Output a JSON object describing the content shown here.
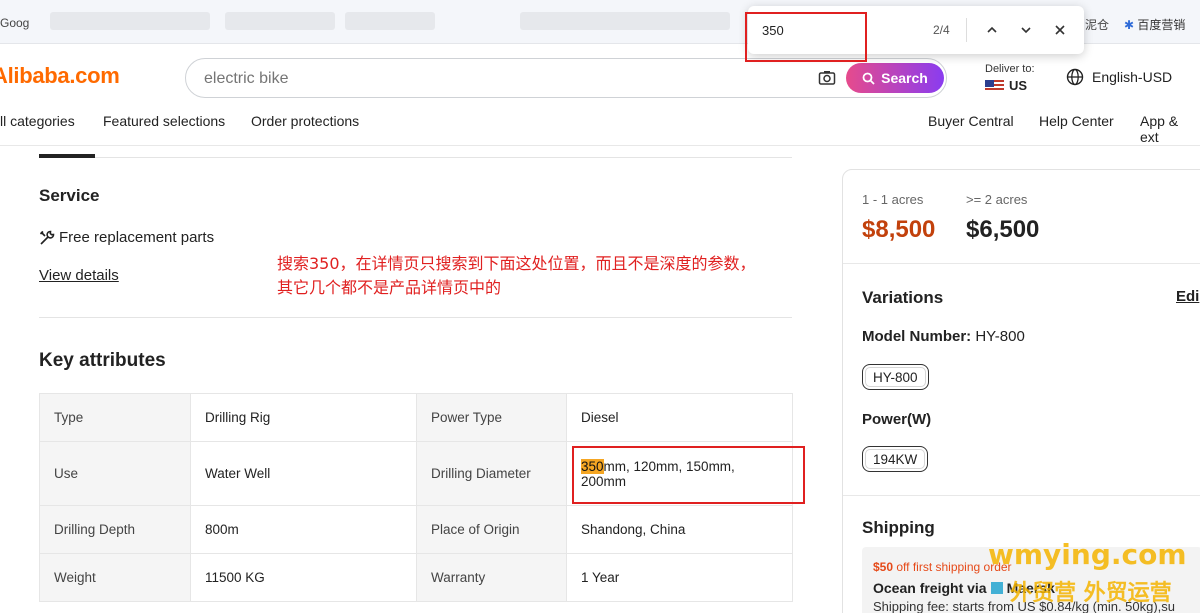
{
  "bookmarks": {
    "first": "Goog",
    "right_1": "泥仓",
    "right_2": "百度营销"
  },
  "findbar": {
    "query": "350",
    "count": "2/4"
  },
  "header": {
    "logo": "Alibaba.com",
    "search_placeholder": "electric bike",
    "search_button": "Search",
    "deliver_label": "Deliver to:",
    "deliver_value": "US",
    "language": "English-USD"
  },
  "nav": {
    "left": [
      "ll categories",
      "Featured selections",
      "Order protections"
    ],
    "right": [
      "Buyer Central",
      "Help Center",
      "App & ext"
    ]
  },
  "service": {
    "title": "Service",
    "item": "Free replacement parts",
    "link": "View details"
  },
  "annotation": {
    "line1": "搜索350，在详情页只搜索到下面这处位置，而且不是深度的参数，",
    "line2": "其它几个都不是产品详情页中的"
  },
  "key_attributes": {
    "title": "Key attributes",
    "rows": [
      {
        "k1": "Type",
        "v1": "Drilling Rig",
        "k2": "Power Type",
        "v2": "Diesel"
      },
      {
        "k1": "Use",
        "v1": "Water Well",
        "k2": "Drilling Diameter",
        "v2_highlight": "350",
        "v2_rest": "mm, 120mm, 150mm,",
        "v2_line2": "200mm"
      },
      {
        "k1": "Drilling Depth",
        "v1": "800m",
        "k2": "Place of Origin",
        "v2": "Shandong, China"
      },
      {
        "k1": "Weight",
        "v1": "11500 KG",
        "k2": "Warranty",
        "v2": "1 Year"
      }
    ]
  },
  "pricing": {
    "tiers": [
      {
        "label": "1 - 1 acres",
        "price": "$8,500"
      },
      {
        "label": ">= 2 acres",
        "price": "$6,500"
      }
    ]
  },
  "variations": {
    "title": "Variations",
    "edit": "Edi",
    "model_label": "Model Number:",
    "model_value": "HY-800",
    "model_chip": "HY-800",
    "power_label": "Power(W)",
    "power_chip": "194KW"
  },
  "shipping": {
    "title": "Shipping",
    "promo_amount": "$50",
    "promo_text": "off first shipping order",
    "freight": "Ocean freight via",
    "carrier": "Maersk",
    "fee": "Shipping fee: starts from US $0.84/kg (min. 50kg),su"
  },
  "watermark": {
    "line1": "wmying.com",
    "line2": "外贸营 外贸运营"
  },
  "colors": {
    "brand": "#ff6a00",
    "price_accent": "#c2410c",
    "annotation_red": "#e02020",
    "highlight": "#f5a623"
  }
}
